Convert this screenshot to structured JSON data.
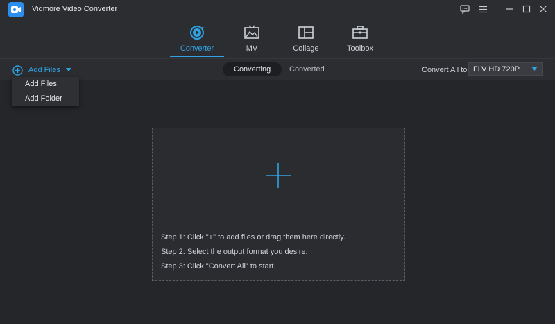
{
  "app": {
    "title": "Vidmore Video Converter"
  },
  "nav": {
    "tabs": [
      {
        "label": "Converter",
        "icon": "converter-icon",
        "active": true
      },
      {
        "label": "MV",
        "icon": "mv-icon",
        "active": false
      },
      {
        "label": "Collage",
        "icon": "collage-icon",
        "active": false
      },
      {
        "label": "Toolbox",
        "icon": "toolbox-icon",
        "active": false
      }
    ]
  },
  "toolbar": {
    "add_files_label": "Add Files",
    "segments": [
      "Converting",
      "Converted"
    ],
    "active_segment": "Converting",
    "convert_all_label": "Convert All to:",
    "format_value": "FLV HD 720P"
  },
  "dropdown": {
    "items": [
      "Add Files",
      "Add Folder"
    ]
  },
  "dropzone": {
    "steps": [
      "Step 1: Click \"+\" to add files or drag them here directly.",
      "Step 2: Select the output format you desire.",
      "Step 3: Click \"Convert All\" to start."
    ]
  },
  "colors": {
    "accent": "#2fa3e6",
    "background": "#252629",
    "panel": "#2c2d31"
  }
}
